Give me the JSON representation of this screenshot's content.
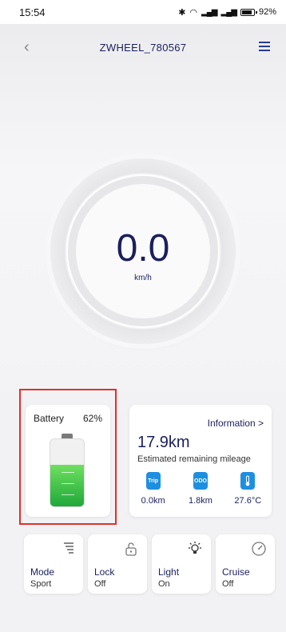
{
  "status_bar": {
    "time": "15:54",
    "battery": "92%"
  },
  "nav": {
    "title": "ZWHEEL_780567"
  },
  "speed": {
    "value": "0.0",
    "unit": "km/h"
  },
  "battery": {
    "label": "Battery",
    "percent_text": "62%",
    "level": 0.62,
    "fill_color": "#2bb84a"
  },
  "info": {
    "link": "Information >",
    "mileage": "17.9km",
    "mileage_label": "Estimated remaining mileage",
    "stats": [
      {
        "icon_text": "Trip",
        "icon": "trip-icon",
        "value": "0.0km"
      },
      {
        "icon_text": "ODO",
        "icon": "odo-icon",
        "value": "1.8km"
      },
      {
        "icon_text": "",
        "icon": "thermometer-icon",
        "value": "27.6°C"
      }
    ]
  },
  "controls": [
    {
      "label": "Mode",
      "value": "Sport",
      "icon": "signal-bars-icon"
    },
    {
      "label": "Lock",
      "value": "Off",
      "icon": "unlock-icon"
    },
    {
      "label": "Light",
      "value": "On",
      "icon": "lightbulb-icon"
    },
    {
      "label": "Cruise",
      "value": "Off",
      "icon": "speedometer-icon"
    }
  ],
  "colors": {
    "primary": "#1b1f5e",
    "accent": "#1d8fe0",
    "highlight": "#e0302c"
  }
}
